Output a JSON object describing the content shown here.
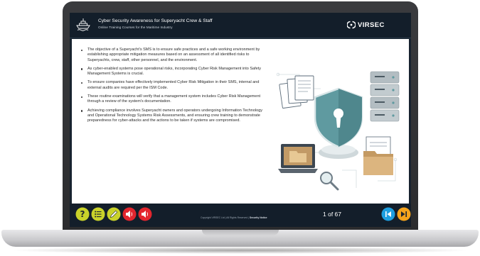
{
  "header": {
    "title": "Cyber Security Awareness for Superyacht Crew & Staff",
    "subtitle": "Online Training Courses for the Maritime Industry",
    "brand": "VIRSEC"
  },
  "content": {
    "bullets": [
      "The objective of a Superyacht's SMS is to ensure safe practices and a safe working environment by establishing appropriate mitigation measures based on an assessment of all identified risks to Superyachts, crew, staff, other personnel, and the environment.",
      "As cyber-enabled systems pose operational risks, incorporating Cyber Risk Management into Safety Management Systems is crucial.",
      "To ensure companies have effectively implemented Cyber Risk Mitigation in their SMS, internal and external audits are required per the ISM Code.",
      "These routine examinations will verify that a management system includes Cyber Risk Management through a review of the system's documentation.",
      "Achieving compliance involves Superyacht owners and operators undergoing Information Technology and Operational Technology Systems Risk Assessments, and ensuring crew training to demonstrate preparedness for cyber-attacks and the actions to be taken if systems are compromised."
    ]
  },
  "footer": {
    "copyright": "Copyright VIRSEC Ltd  |  All Rights Reserved  |",
    "security_notice": "Security Notice",
    "page_counter": "1 of 67"
  },
  "icons": {
    "help": "question-mark-icon",
    "menu": "list-icon",
    "notes": "pencil-icon",
    "audio_1": "speaker-icon",
    "audio_2": "speaker-icon",
    "previous": "skip-back-icon",
    "next": "skip-forward-icon"
  },
  "colors": {
    "help": "#c9d22a",
    "menu": "#c9d22a",
    "notes": "#c9d22a",
    "audio": "#e3262e",
    "previous": "#1e9fe0",
    "next": "#f5a31c",
    "header_bg": "#131e2a"
  }
}
